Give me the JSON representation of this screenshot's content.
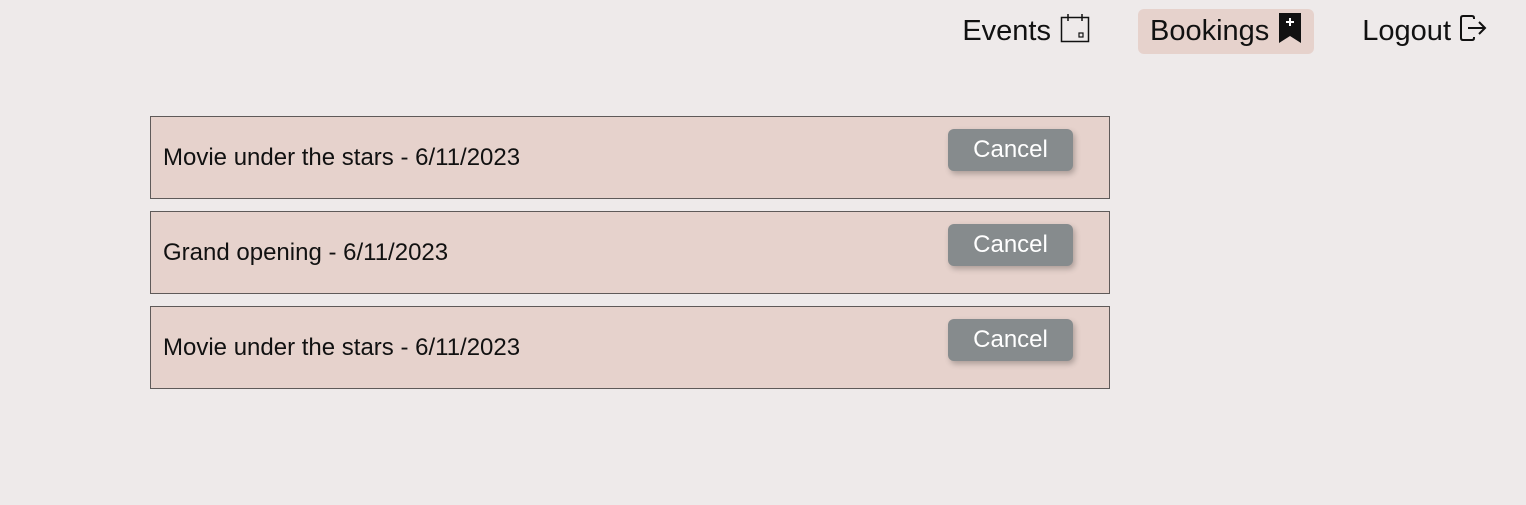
{
  "nav": {
    "items": [
      {
        "label": "Events",
        "icon": "calendar-icon",
        "active": false
      },
      {
        "label": "Bookings",
        "icon": "bookmark-plus-icon",
        "active": true
      },
      {
        "label": "Logout",
        "icon": "logout-icon",
        "active": false
      }
    ],
    "active_color": "#e6d2cc"
  },
  "bookings": [
    {
      "title": "Movie under the stars - 6/11/2023",
      "action_label": "Cancel"
    },
    {
      "title": "Grand opening - 6/11/2023",
      "action_label": "Cancel"
    },
    {
      "title": "Movie under the stars - 6/11/2023",
      "action_label": "Cancel"
    }
  ],
  "colors": {
    "background": "#eeeaea",
    "card": "#e6d2cc",
    "button": "#868b8d"
  }
}
